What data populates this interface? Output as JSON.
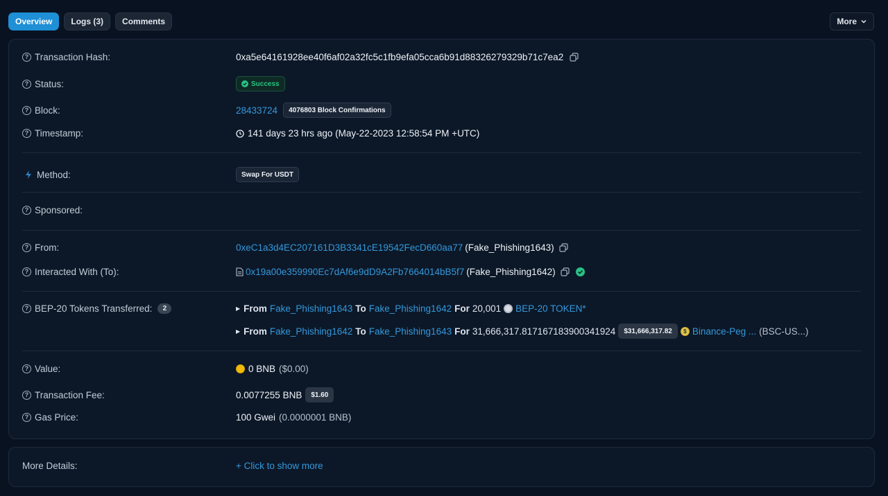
{
  "tabs": [
    {
      "label": "Overview",
      "active": true
    },
    {
      "label": "Logs (3)",
      "active": false
    },
    {
      "label": "Comments",
      "active": false
    }
  ],
  "more_button": {
    "label": "More"
  },
  "rows": {
    "tx_hash": {
      "label": "Transaction Hash:",
      "value": "0xa5e64161928ee40f6af02a32fc5c1fb9efa05cca6b91d88326279329b71c7ea2"
    },
    "status": {
      "label": "Status:",
      "value": "Success"
    },
    "block": {
      "label": "Block:",
      "value": "28433724",
      "confirmations": "4076803 Block Confirmations"
    },
    "timestamp": {
      "label": "Timestamp:",
      "value": "141 days 23 hrs ago (May-22-2023 12:58:54 PM +UTC)"
    },
    "method": {
      "label": "Method:",
      "value": "Swap For USDT"
    },
    "sponsored": {
      "label": "Sponsored:"
    },
    "from": {
      "label": "From:",
      "address": "0xeC1a3d4EC207161D3B3341cE19542FecD660aa77",
      "name": "(Fake_Phishing1643)"
    },
    "to": {
      "label": "Interacted With (To):",
      "address": "0x19a00e359990Ec7dAf6e9dD9A2Fb7664014bB5f7",
      "name": "(Fake_Phishing1642)"
    },
    "tokens": {
      "label": "BEP-20 Tokens Transferred:",
      "count": "2",
      "transfers": [
        {
          "from_kw": "From",
          "from": "Fake_Phishing1643",
          "to_kw": "To",
          "to": "Fake_Phishing1642",
          "for_kw": "For",
          "amount": "20,001",
          "token": "BEP-20 TOKEN*"
        },
        {
          "from_kw": "From",
          "from": "Fake_Phishing1642",
          "to_kw": "To",
          "to": "Fake_Phishing1643",
          "for_kw": "For",
          "amount": "31,666,317.817167183900341924",
          "usd": "$31,666,317.82",
          "token": "Binance-Peg ...",
          "token_suffix": "(BSC-US...)"
        }
      ]
    },
    "value": {
      "label": "Value:",
      "amount": "0 BNB",
      "usd": "($0.00)"
    },
    "fee": {
      "label": "Transaction Fee:",
      "amount": "0.0077255 BNB",
      "usd": "$1.60"
    },
    "gas": {
      "label": "Gas Price:",
      "amount": "100 Gwei",
      "detail": "(0.0000001 BNB)"
    }
  },
  "more_details": {
    "label": "More Details:",
    "link": "+ Click to show more"
  },
  "colors": {
    "accent": "#3498db",
    "success": "#28c285",
    "background": "#081221"
  },
  "icons": [
    "help-circle-icon",
    "copy-icon",
    "clock-icon",
    "lightning-icon",
    "contract-file-icon",
    "verified-check-icon",
    "caret-right-icon",
    "chevron-down-icon",
    "bnb-coin-icon"
  ]
}
